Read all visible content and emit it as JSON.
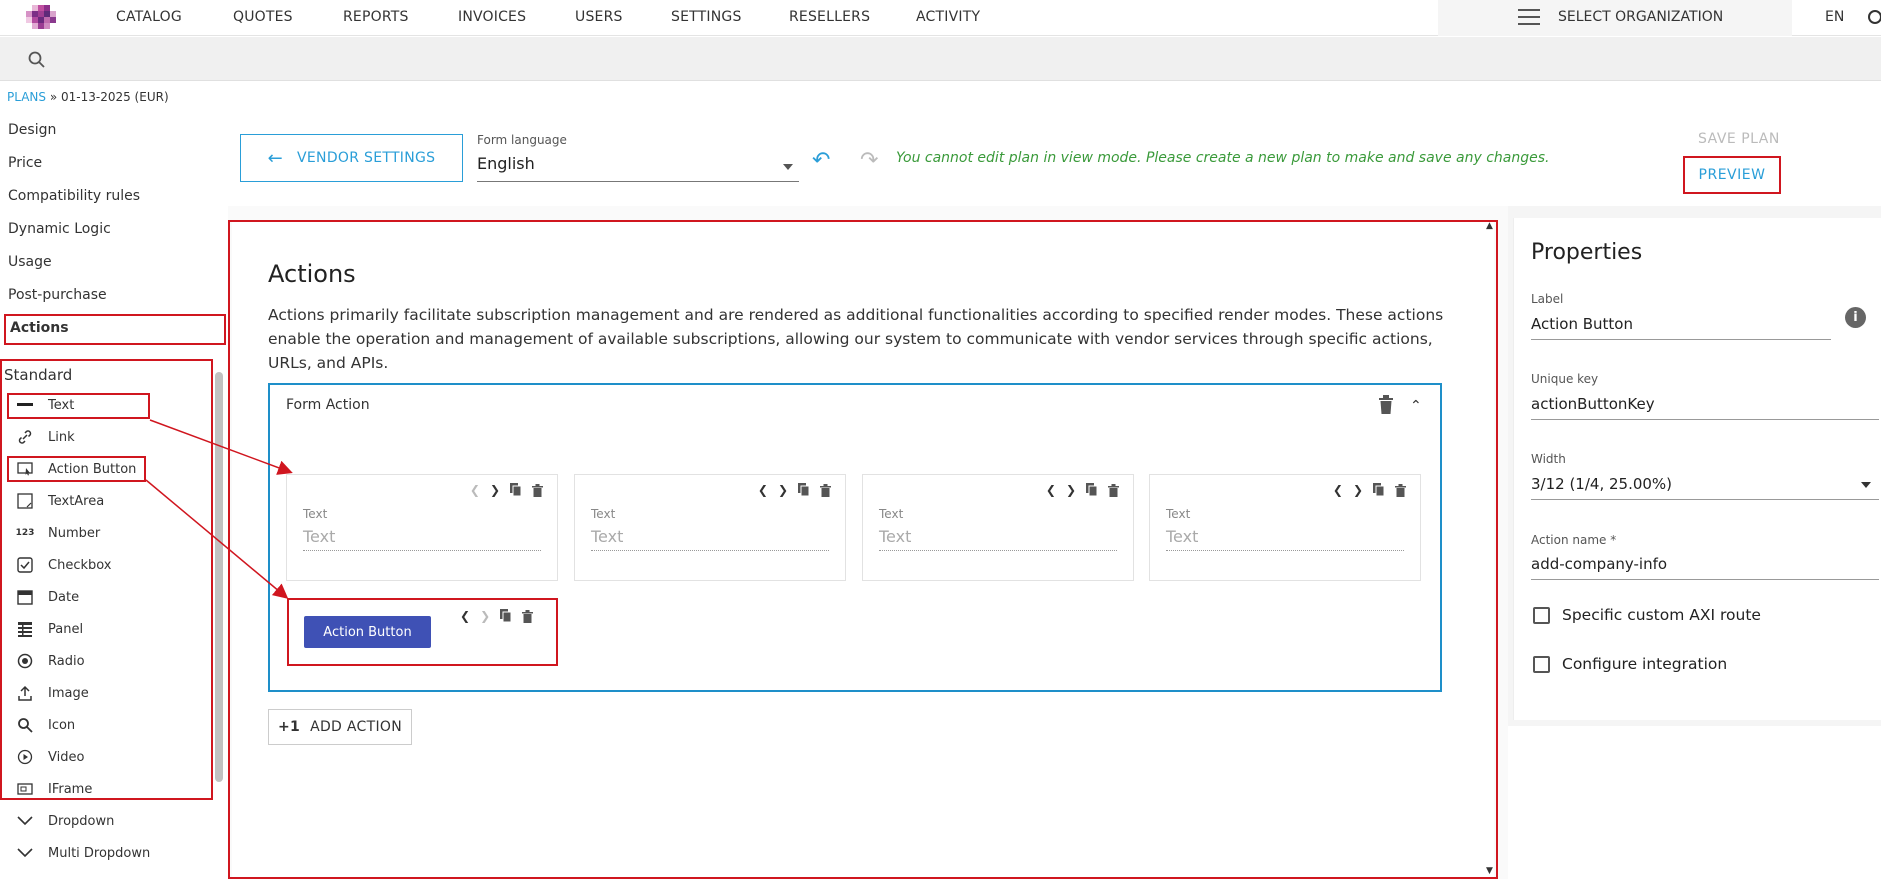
{
  "nav": {
    "items": [
      "CATALOG",
      "QUOTES",
      "REPORTS",
      "INVOICES",
      "USERS",
      "SETTINGS",
      "RESELLERS",
      "ACTIVITY"
    ],
    "org_label": "SELECT ORGANIZATION",
    "lang": "EN"
  },
  "breadcrumb": {
    "root": "PLANS",
    "sep": "»",
    "current": "01-13-2025 (EUR)"
  },
  "sidebar": {
    "items": [
      "Design",
      "Price",
      "Compatibility rules",
      "Dynamic Logic",
      "Usage",
      "Post-purchase",
      "Actions"
    ],
    "palette_title": "Standard",
    "palette": [
      {
        "label": "Text",
        "icon": "text-line-icon"
      },
      {
        "label": "Link",
        "icon": "link-icon"
      },
      {
        "label": "Action Button",
        "icon": "action-button-icon"
      },
      {
        "label": "TextArea",
        "icon": "textarea-icon"
      },
      {
        "label": "Number",
        "icon": "number-icon"
      },
      {
        "label": "Checkbox",
        "icon": "checkbox-icon"
      },
      {
        "label": "Date",
        "icon": "calendar-icon"
      },
      {
        "label": "Panel",
        "icon": "panel-icon"
      },
      {
        "label": "Radio",
        "icon": "radio-icon"
      },
      {
        "label": "Image",
        "icon": "upload-icon"
      },
      {
        "label": "Icon",
        "icon": "search-icon"
      },
      {
        "label": "Video",
        "icon": "video-icon"
      },
      {
        "label": "IFrame",
        "icon": "iframe-icon"
      },
      {
        "label": "Dropdown",
        "icon": "chevron-down-icon"
      },
      {
        "label": "Multi Dropdown",
        "icon": "chevron-down-icon"
      }
    ]
  },
  "toolbar": {
    "vendor_settings": "VENDOR SETTINGS",
    "form_language_label": "Form language",
    "form_language": "English",
    "notice": "You cannot edit plan in view mode. Please create a new plan to make and save any changes.",
    "save_plan": "SAVE PLAN",
    "preview": "PREVIEW"
  },
  "main": {
    "title": "Actions",
    "description": "Actions primarily facilitate subscription management and are rendered as additional functionalities according to specified render modes. These actions enable the operation and management of available subscriptions, allowing our system to communicate with vendor services through specific actions, URLs, and APIs.",
    "form_action_title": "Form Action",
    "fields": [
      {
        "label": "Text",
        "placeholder": "Text"
      },
      {
        "label": "Text",
        "placeholder": "Text"
      },
      {
        "label": "Text",
        "placeholder": "Text"
      },
      {
        "label": "Text",
        "placeholder": "Text"
      }
    ],
    "action_button": "Action Button",
    "add_action_prefix": "+1",
    "add_action": "ADD ACTION"
  },
  "properties": {
    "title": "Properties",
    "label_label": "Label",
    "label_value": "Action Button",
    "key_label": "Unique key",
    "key_value": "actionButtonKey",
    "width_label": "Width",
    "width_value": "3/12 (1/4, 25.00%)",
    "name_label": "Action name *",
    "name_value": "add-company-info",
    "chk1": "Specific custom AXI route",
    "chk2": "Configure integration"
  },
  "colors": {
    "accent": "#2a9ed8",
    "highlight": "#d0161f",
    "button": "#3f51b5",
    "notice": "#3a9a3a"
  }
}
